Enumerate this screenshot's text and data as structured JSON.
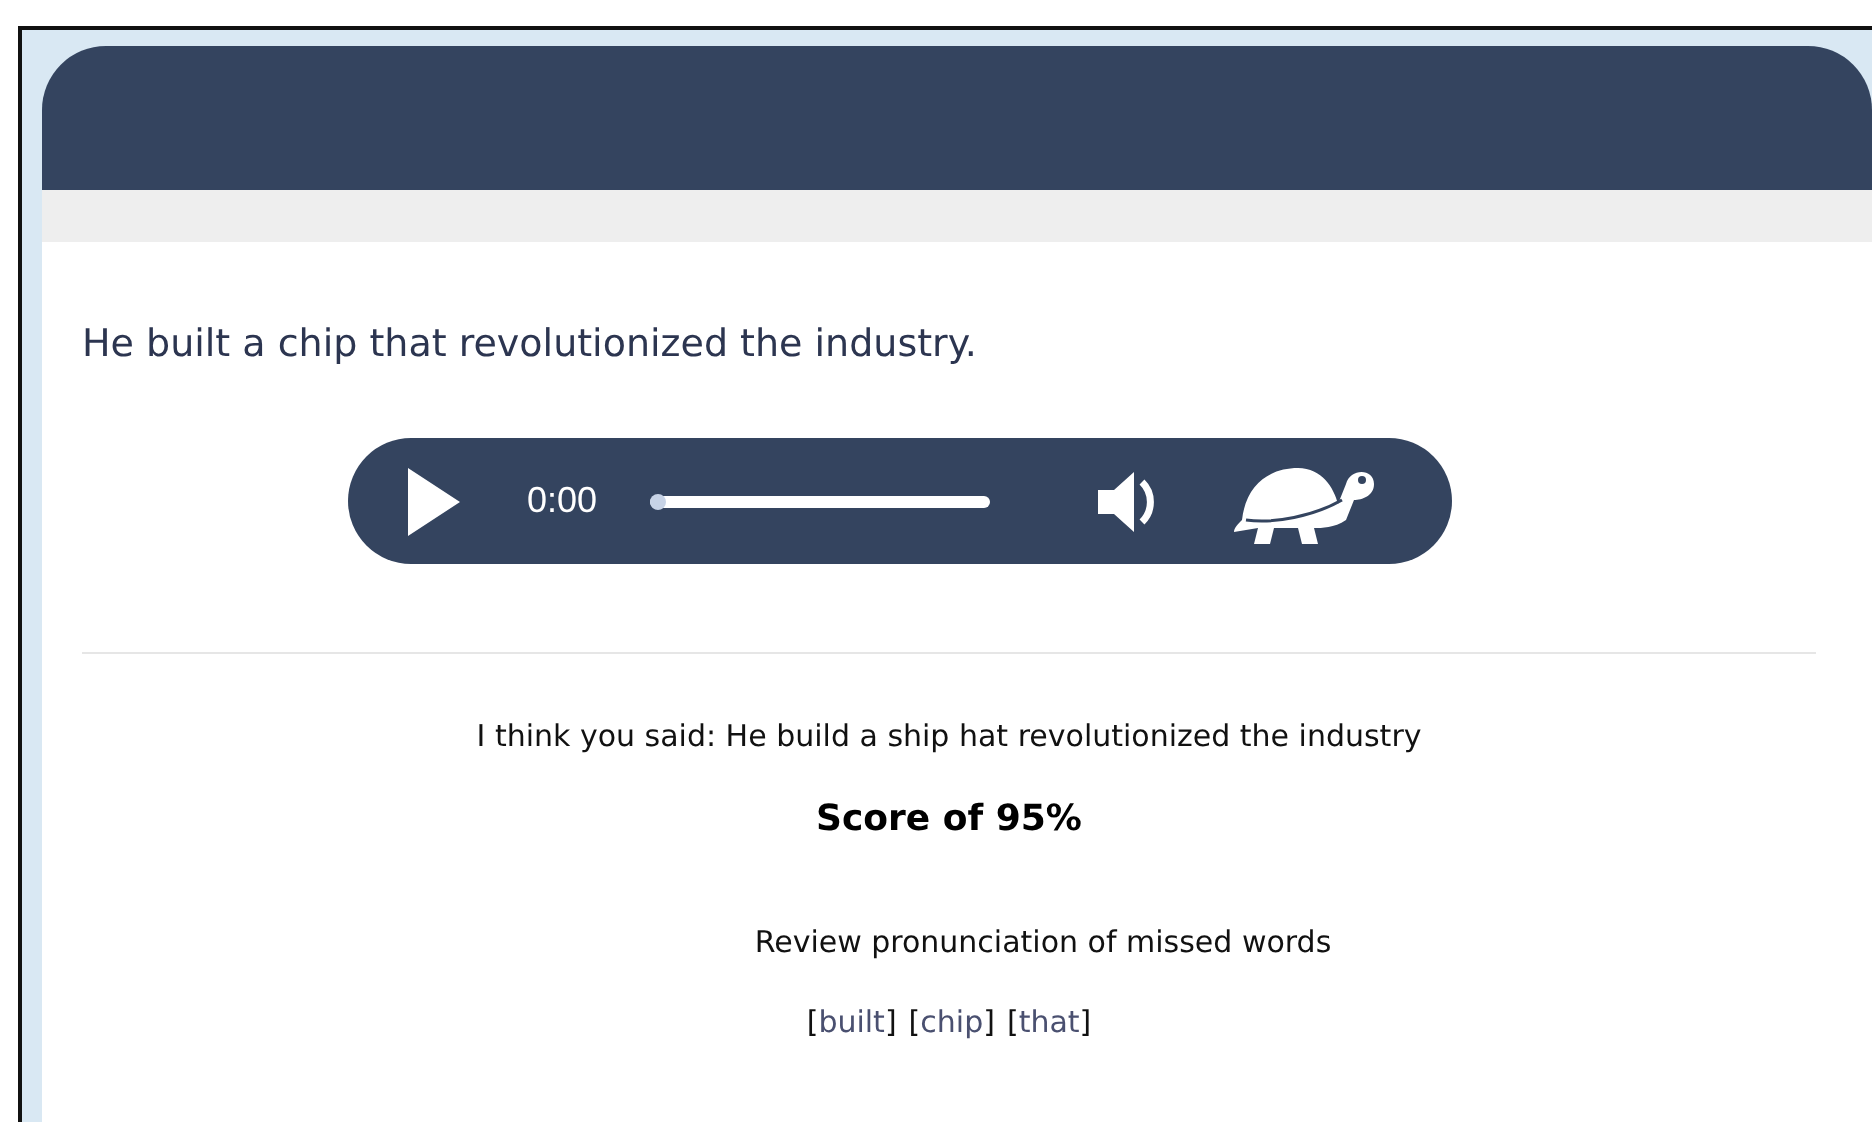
{
  "sentence": "He built a chip that revolutionized the industry.",
  "player": {
    "time": "0:00",
    "level": 0
  },
  "recognized": "I think you said: He build a ship hat revolutionized the industry",
  "score": "Score of 95%",
  "review_heading": "Review pronunciation of missed words",
  "missed_words": [
    {
      "open": "[",
      "word": "built",
      "close": "]"
    },
    {
      "open": "[",
      "word": "chip",
      "close": "]"
    },
    {
      "open": "[",
      "word": "that",
      "close": "]"
    }
  ]
}
